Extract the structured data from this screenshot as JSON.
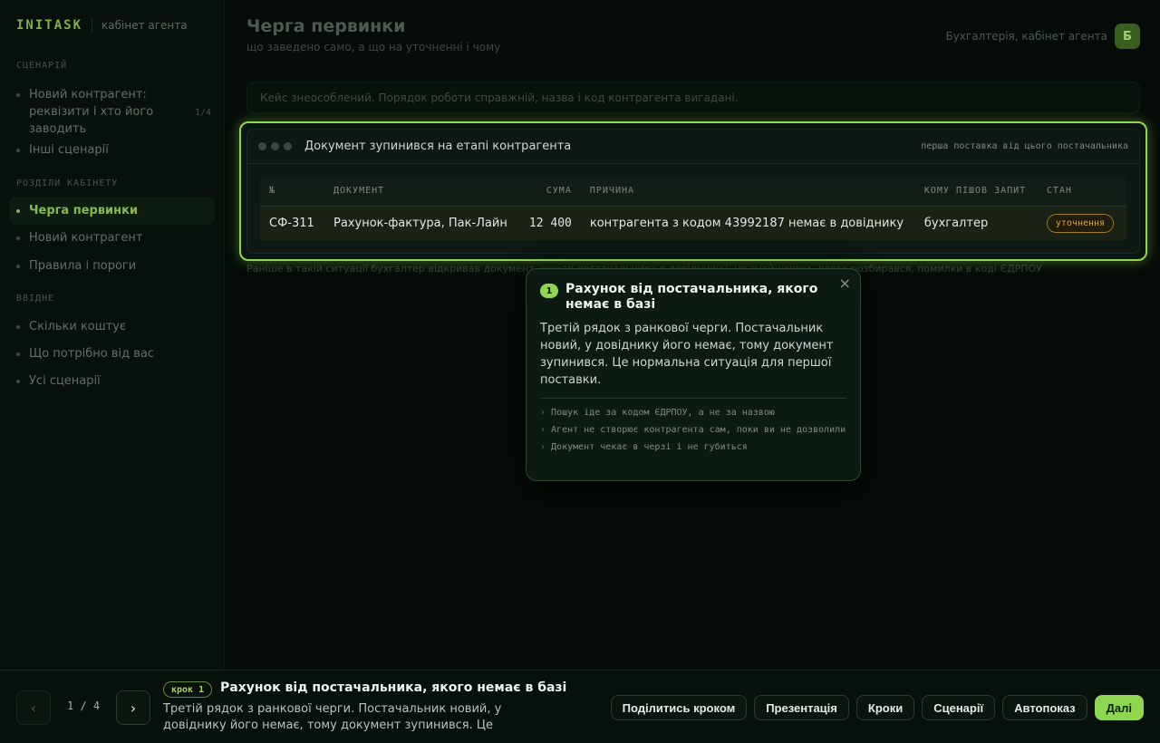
{
  "brand": {
    "logo": "INITASK",
    "subtitle": "кабінет агента"
  },
  "sidebar": {
    "section_scenario": "СЦЕНАРІЙ",
    "scenario_items": [
      {
        "label": "Новий контрагент: реквізити і хто його заводить",
        "count": "1/4"
      },
      {
        "label": "Інші сценарії"
      }
    ],
    "section_sections": "РОЗДІЛИ КАБІНЕТУ",
    "section_items": [
      {
        "label": "Черга первинки"
      },
      {
        "label": "Новий контрагент"
      },
      {
        "label": "Правила і пороги"
      }
    ],
    "section_other": "ВВІДНЕ",
    "other_items": [
      {
        "label": "Скільки коштує"
      },
      {
        "label": "Що потрібно від вас"
      },
      {
        "label": "Усі сценарії"
      }
    ]
  },
  "header": {
    "title": "Черга первинки",
    "subtitle": "що заведено само, а що на уточненні і чому",
    "context": "Бухгалтерія, кабінет агента",
    "avatar_letter": "Б"
  },
  "notice": "Кейс знеособлений. Порядок роботи справжній, назва і код контрагента вигадані.",
  "below_text": "Раніше в такій ситуації бухгалтер відкривав документ, шукав постачальника в довіднику і, не знайшовши, довго розбирався, помилки в коді ЄДРПОУ",
  "card": {
    "title": "Документ зупинився на етапі контрагента",
    "note": "перша поставка від цього постачальника",
    "columns": [
      "№",
      "ДОКУМЕНТ",
      "СУМА",
      "ПРИЧИНА",
      "КОМУ ПІШОВ ЗАПИТ",
      "СТАН"
    ],
    "row": {
      "num": "СФ-311",
      "doc": "Рахунок-фактура, Пак-Лайн",
      "sum": "12 400",
      "reason": "контрагента з кодом 43992187 немає в довіднику",
      "to": "бухгалтер",
      "status": "уточнення"
    }
  },
  "popover": {
    "step": "1",
    "title": "Рахунок від постачальника, якого немає в базі",
    "body": "Третій рядок з ранкової черги. Постачальник новий, у довіднику його немає, тому документ зупинився. Це нормальна ситуація для першої поставки.",
    "points": [
      "Пошук іде за кодом ЄДРПОУ, а не за назвою",
      "Агент не створює контрагента сам, поки ви не дозволили",
      "Документ чекає в черзі і не губиться"
    ],
    "close": "×"
  },
  "bottom": {
    "prev": "‹",
    "next": "›",
    "pager": "1 / 4",
    "step_tag": "крок",
    "step_num": "1",
    "title": "Рахунок від постачальника, якого немає в базі",
    "desc": "Третій рядок з ранкової черги. Постачальник новий, у довіднику його немає, тому документ зупинився. Це нормальна ситуація д…",
    "actions": {
      "share": "Поділитись кроком",
      "present": "Презентація",
      "steps": "Кроки",
      "scenarios": "Сценарії",
      "autoplay": "Автопоказ",
      "next": "Далі"
    }
  },
  "colors": {
    "accent": "#8fd650",
    "warning": "#d7a83a",
    "background": "#050b07"
  }
}
